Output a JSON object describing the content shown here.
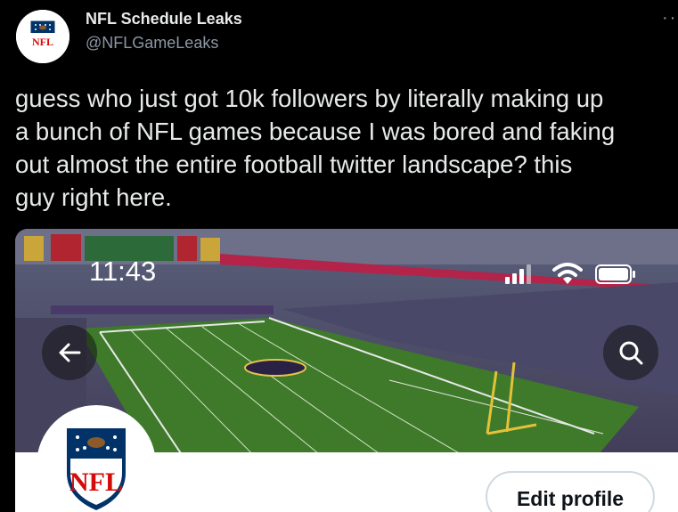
{
  "tweet": {
    "display_name": "NFL Schedule Leaks",
    "handle": "@NFLGameLeaks",
    "text": "guess who just got 10k followers by literally making up\na bunch of NFL games because I was bored and faking\nout almost the entire football twitter landscape? this\nguy right here.",
    "more_icon": "more-dots-icon"
  },
  "screenshot": {
    "status_time": "11:43",
    "avatar_logo_text": "NFL",
    "edit_profile_label": "Edit profile",
    "icons": [
      "back-arrow-icon",
      "search-icon",
      "cell-signal-icon",
      "wifi-icon",
      "battery-icon"
    ]
  },
  "colors": {
    "background": "#000000",
    "text": "#e7e9ea",
    "muted": "#8b98a5",
    "nfl_blue": "#013369",
    "nfl_red": "#d50a0a",
    "field_green": "#3e7a2a"
  }
}
